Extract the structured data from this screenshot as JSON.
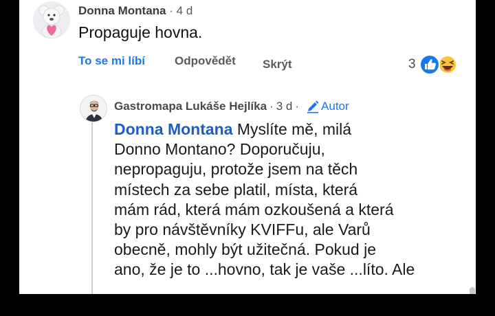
{
  "comment": {
    "author": "Donna Montana",
    "separator": "·",
    "age": "4 d",
    "text": "Propaguje hovna.",
    "actions": {
      "like": "To se mi líbí",
      "reply": "Odpovědět",
      "hide": "Skrýt"
    },
    "reaction_count": "3",
    "reaction_icons": [
      "like-reaction-icon",
      "haha-reaction-icon"
    ],
    "accent_color": "#1876f2"
  },
  "reply": {
    "author": "Gastromapa Lukáše Hejlíka",
    "separator": "·",
    "age": "3 d",
    "separator2": "·",
    "badge": "Autor",
    "mention": "Donna Montana",
    "lines": [
      "Myslíte mě, milá",
      "Donno Montano? Doporučuju,",
      "nepropaguju, protože jsem na těch",
      "místech za sebe platil, místa, která",
      "mám rád, která mám ozkoušená a která",
      "by pro návštěvníky KVIFFu, ale Varů",
      "obecně, mohly být užitečná. Pokud je",
      "ano, že je to ...hovno, tak je vaše ...líto. Ale"
    ]
  }
}
